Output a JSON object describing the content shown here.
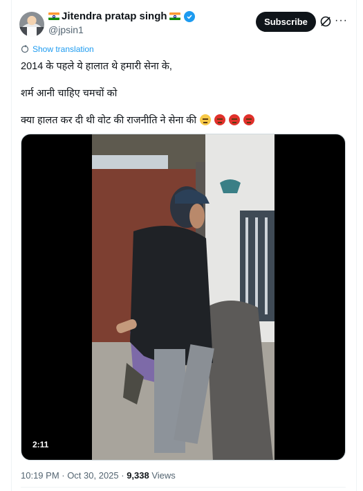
{
  "author": {
    "display_name": "Jitendra pratap singh",
    "handle": "@jpsin1"
  },
  "actions": {
    "subscribe_label": "Subscribe",
    "more_label": "···"
  },
  "translation": {
    "label": "Show translation"
  },
  "tweet": {
    "line1": "2014 के पहले ये हालात थे हमारी सेना के,",
    "line2": "शर्म आनी चाहिए चमचों को",
    "line3": "क्या हालत कर दी थी वोट की राजनीति ने सेना की"
  },
  "media": {
    "duration": "2:11"
  },
  "meta": {
    "time_date": "10:19 PM · Oct 30, 2025 · ",
    "views_count": "9,338",
    "views_label": " Views"
  },
  "colors": {
    "accent": "#1d9bf0",
    "text": "#0f1419",
    "secondary": "#536471",
    "button_bg": "#0f1419"
  }
}
